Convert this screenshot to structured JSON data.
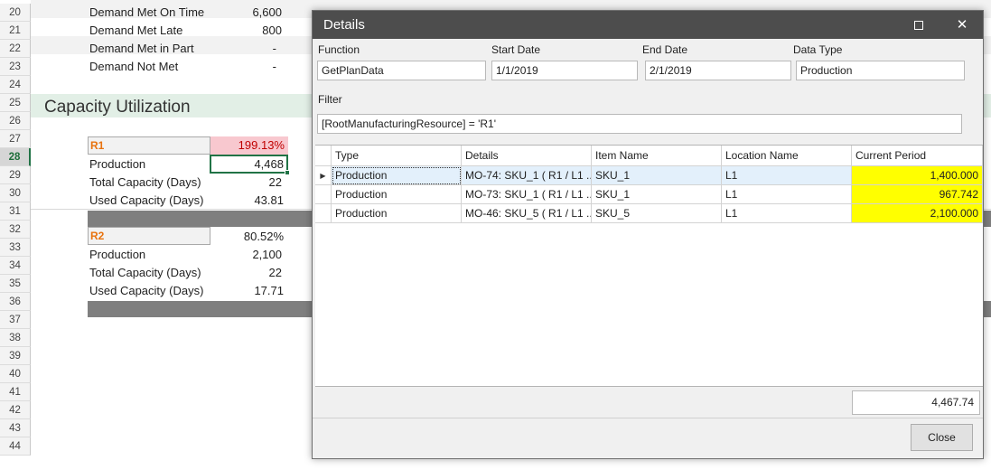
{
  "sheet": {
    "row_numbers": [
      "20",
      "21",
      "22",
      "23",
      "24",
      "25",
      "26",
      "27",
      "28",
      "29",
      "30",
      "31",
      "32",
      "33",
      "34",
      "35",
      "36",
      "37",
      "38",
      "39",
      "40",
      "41",
      "42",
      "43",
      "44"
    ],
    "rows": {
      "r20": {
        "label": "Demand Met On Time",
        "value": "6,600"
      },
      "r21": {
        "label": "Demand Met Late",
        "value": "800"
      },
      "r22": {
        "label": "Demand Met in Part",
        "value": "-"
      },
      "r23": {
        "label": "Demand Not Met",
        "value": "-"
      }
    },
    "section_title": "Capacity Utilization",
    "r1": {
      "name": "R1",
      "percent": "199.13%",
      "production_label": "Production",
      "production": "4,468",
      "total_label": "Total Capacity (Days)",
      "total": "22",
      "used_label": "Used Capacity (Days)",
      "used": "43.81"
    },
    "r2": {
      "name": "R2",
      "percent": "80.52%",
      "production_label": "Production",
      "production": "2,100",
      "total_label": "Total Capacity (Days)",
      "total": "22",
      "used_label": "Used Capacity (Days)",
      "used": "17.71"
    }
  },
  "dialog": {
    "title": "Details",
    "maximize_label": "",
    "close_glyph": "✕",
    "fields": {
      "function_label": "Function",
      "function_value": "GetPlanData",
      "start_label": "Start Date",
      "start_value": "1/1/2019",
      "end_label": "End  Date",
      "end_value": "2/1/2019",
      "datatype_label": "Data Type",
      "datatype_value": "Production",
      "filter_label": "Filter",
      "filter_value": "[RootManufacturingResource] = 'R1'"
    },
    "grid": {
      "columns": [
        "Type",
        "Details",
        "Item Name",
        "Location Name",
        "Current Period"
      ],
      "rows": [
        {
          "type": "Production",
          "details": "MO-74: SKU_1 ( R1 / L1 ...",
          "item": "SKU_1",
          "location": "L1",
          "period": "1,400.000"
        },
        {
          "type": "Production",
          "details": "MO-73: SKU_1 ( R1 / L1 ...",
          "item": "SKU_1",
          "location": "L1",
          "period": "967.742"
        },
        {
          "type": "Production",
          "details": "MO-46: SKU_5 ( R1 / L1 ...",
          "item": "SKU_5",
          "location": "L1",
          "period": "2,100.000"
        }
      ],
      "row_indicator": "▶"
    },
    "total": "4,467.74",
    "close_button": "Close"
  },
  "colors": {
    "titlebar": "#4d4d4d",
    "highlight_yellow": "#ffff00",
    "r1_pink": "#f8c8cf",
    "resource_orange": "#e8730f",
    "excel_green": "#217346"
  }
}
